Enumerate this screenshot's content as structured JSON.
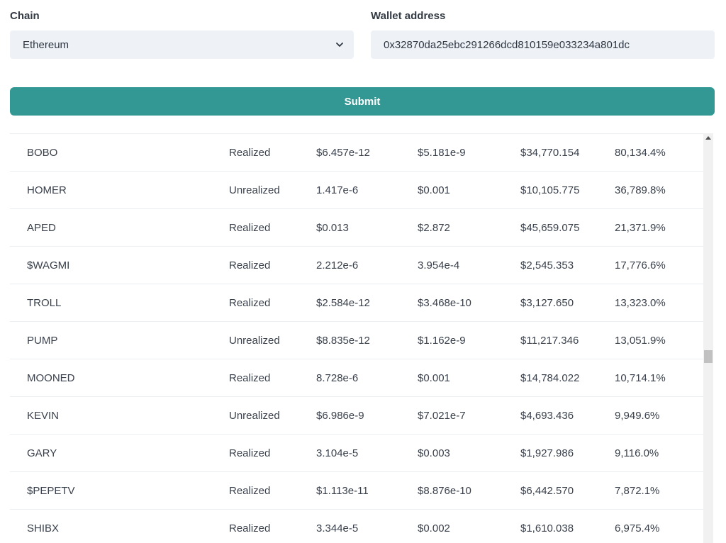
{
  "form": {
    "chain_label": "Chain",
    "chain_value": "Ethereum",
    "wallet_label": "Wallet address",
    "wallet_value": "0x32870da25ebc291266dcd810159e033234a801dc",
    "submit_label": "Submit"
  },
  "icons": {
    "select": "chevron-down-icon",
    "scroll": "arrow-up-icon"
  },
  "colors": {
    "accent": "#339893",
    "input_bg": "#eef2f6"
  },
  "table": {
    "rows": [
      [
        "BOBO",
        "Realized",
        "$6.457e-12",
        "$5.181e-9",
        "$34,770.154",
        "80,134.4%"
      ],
      [
        "HOMER",
        "Unrealized",
        "1.417e-6",
        "$0.001",
        "$10,105.775",
        "36,789.8%"
      ],
      [
        "APED",
        "Realized",
        "$0.013",
        "$2.872",
        "$45,659.075",
        "21,371.9%"
      ],
      [
        "$WAGMI",
        "Realized",
        "2.212e-6",
        "3.954e-4",
        "$2,545.353",
        "17,776.6%"
      ],
      [
        "TROLL",
        "Realized",
        "$2.584e-12",
        "$3.468e-10",
        "$3,127.650",
        "13,323.0%"
      ],
      [
        "PUMP",
        "Unrealized",
        "$8.835e-12",
        "$1.162e-9",
        "$11,217.346",
        "13,051.9%"
      ],
      [
        "MOONED",
        "Realized",
        "8.728e-6",
        "$0.001",
        "$14,784.022",
        "10,714.1%"
      ],
      [
        "KEVIN",
        "Unrealized",
        "$6.986e-9",
        "$7.021e-7",
        "$4,693.436",
        "9,949.6%"
      ],
      [
        "GARY",
        "Realized",
        "3.104e-5",
        "$0.003",
        "$1,927.986",
        "9,116.0%"
      ],
      [
        "$PEPETV",
        "Realized",
        "$1.113e-11",
        "$8.876e-10",
        "$6,442.570",
        "7,872.1%"
      ],
      [
        "SHIBX",
        "Realized",
        "3.344e-5",
        "$0.002",
        "$1,610.038",
        "6,975.4%"
      ]
    ]
  }
}
